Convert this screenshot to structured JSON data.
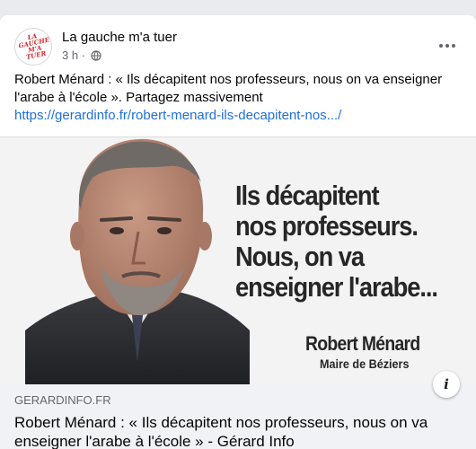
{
  "post": {
    "page_name": "La gauche m'a tuer",
    "avatar_text": "LA GAUCHE M'A TUER",
    "time": "3 h",
    "separator": "·",
    "privacy_icon": "globe-icon",
    "more_icon": "more-options-icon",
    "text": "Robert Ménard : « Ils décapitent nos professeurs, nous on va enseigner l'arabe à l'école ». Partagez massivement",
    "link_url": "https://gerardinfo.fr/robert-menard-ils-decapitent-nos.../"
  },
  "link_preview": {
    "image_quote_lines": [
      "Ils décapitent",
      "nos professeurs.",
      "Nous, on va",
      "enseigner l'arabe..."
    ],
    "image_signature_name": "Robert Ménard",
    "image_signature_role": "Maire de Béziers",
    "info_icon": "info-icon",
    "info_label": "i",
    "domain": "GERARDINFO.FR",
    "title": "Robert Ménard : « Ils décapitent nos professeurs, nous on va enseigner l'arabe à l'école » - Gérard Info"
  },
  "colors": {
    "link": "#216fdb",
    "secondary_text": "#65676b",
    "avatar_red": "#d2232a"
  }
}
